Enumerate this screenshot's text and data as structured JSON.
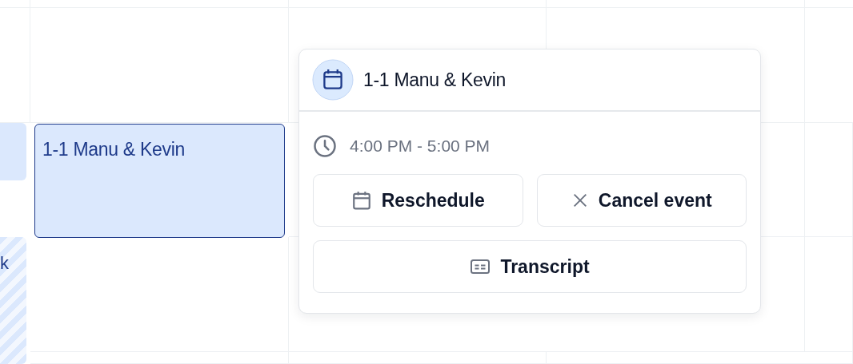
{
  "calendar": {
    "events": [
      {
        "kind": "solid",
        "selected": false
      },
      {
        "kind": "striped",
        "selected": false,
        "title": "k"
      },
      {
        "kind": "solid",
        "selected": true,
        "title": "1-1 Manu & Kevin"
      }
    ]
  },
  "popover": {
    "title": "1-1 Manu & Kevin",
    "time": "4:00 PM - 5:00 PM",
    "actions": [
      {
        "kind": "reschedule",
        "label": "Reschedule"
      },
      {
        "kind": "cancel",
        "label": "Cancel event"
      },
      {
        "kind": "transcript",
        "label": "Transcript"
      }
    ]
  }
}
